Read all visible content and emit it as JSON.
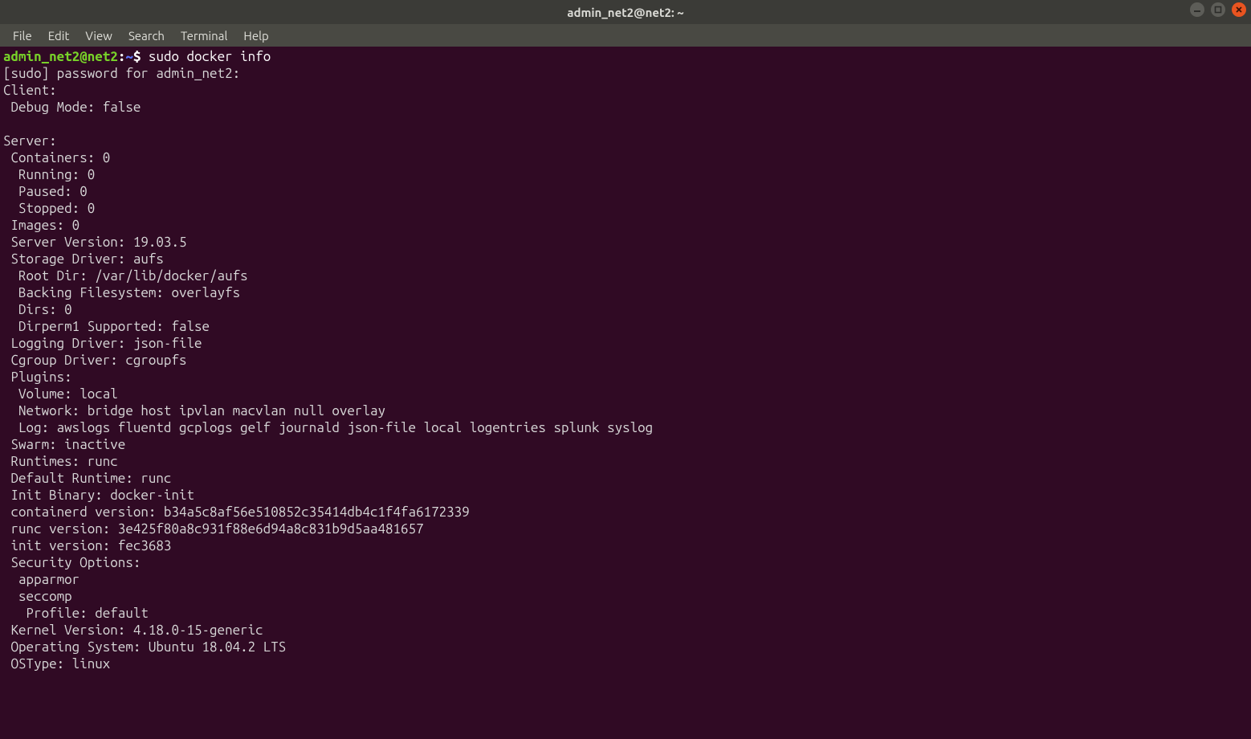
{
  "window": {
    "title": "admin_net2@net2: ~"
  },
  "menu": {
    "file": "File",
    "edit": "Edit",
    "view": "View",
    "search": "Search",
    "terminal": "Terminal",
    "help": "Help"
  },
  "prompt": {
    "user_host": "admin_net2@net2",
    "sep1": ":",
    "path": "~",
    "sep2": "$ ",
    "command": "sudo docker info"
  },
  "lines": {
    "l01": "[sudo] password for admin_net2: ",
    "l02": "Client:",
    "l03": " Debug Mode: false",
    "l04": "",
    "l05": "Server:",
    "l06": " Containers: 0",
    "l07": "  Running: 0",
    "l08": "  Paused: 0",
    "l09": "  Stopped: 0",
    "l10": " Images: 0",
    "l11": " Server Version: 19.03.5",
    "l12": " Storage Driver: aufs",
    "l13": "  Root Dir: /var/lib/docker/aufs",
    "l14": "  Backing Filesystem: overlayfs",
    "l15": "  Dirs: 0",
    "l16": "  Dirperm1 Supported: false",
    "l17": " Logging Driver: json-file",
    "l18": " Cgroup Driver: cgroupfs",
    "l19": " Plugins:",
    "l20": "  Volume: local",
    "l21": "  Network: bridge host ipvlan macvlan null overlay",
    "l22": "  Log: awslogs fluentd gcplogs gelf journald json-file local logentries splunk syslog",
    "l23": " Swarm: inactive",
    "l24": " Runtimes: runc",
    "l25": " Default Runtime: runc",
    "l26": " Init Binary: docker-init",
    "l27": " containerd version: b34a5c8af56e510852c35414db4c1f4fa6172339",
    "l28": " runc version: 3e425f80a8c931f88e6d94a8c831b9d5aa481657",
    "l29": " init version: fec3683",
    "l30": " Security Options:",
    "l31": "  apparmor",
    "l32": "  seccomp",
    "l33": "   Profile: default",
    "l34": " Kernel Version: 4.18.0-15-generic",
    "l35": " Operating System: Ubuntu 18.04.2 LTS",
    "l36": " OSType: linux"
  }
}
